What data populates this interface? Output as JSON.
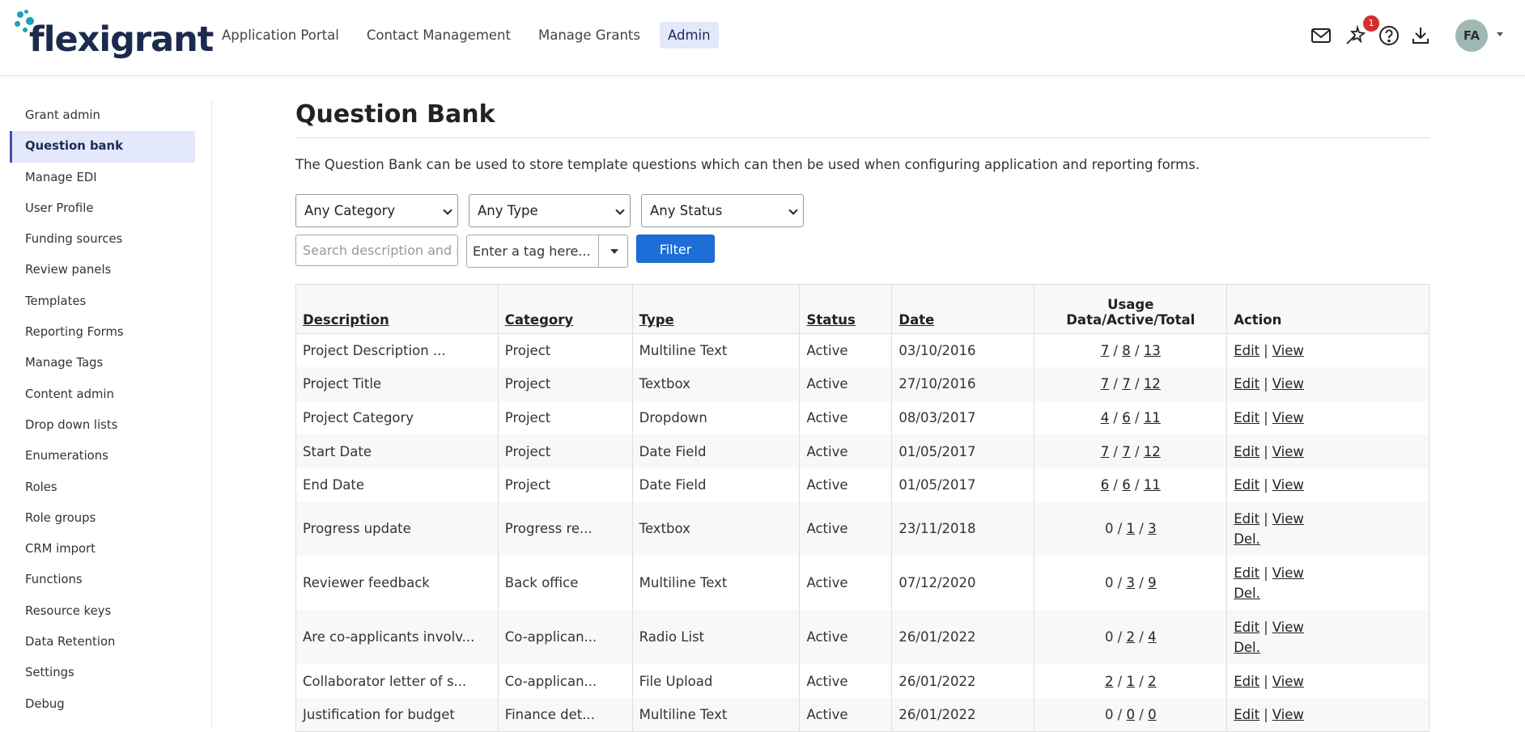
{
  "brand": {
    "name": "flexigrant",
    "accent": "#1aa3b8",
    "navy": "#1b2a4d"
  },
  "nav": {
    "items": [
      {
        "label": "Application Portal",
        "active": false
      },
      {
        "label": "Contact Management",
        "active": false
      },
      {
        "label": "Manage Grants",
        "active": false
      },
      {
        "label": "Admin",
        "active": true
      }
    ]
  },
  "header": {
    "icons": [
      "mail-icon",
      "wand-icon",
      "help-icon",
      "download-icon"
    ],
    "notification_count": "1",
    "avatar_initials": "FA"
  },
  "sidebar": {
    "items": [
      {
        "label": "Grant admin"
      },
      {
        "label": "Question bank",
        "active": true
      },
      {
        "label": "Manage EDI"
      },
      {
        "label": "User Profile"
      },
      {
        "label": "Funding sources"
      },
      {
        "label": "Review panels"
      },
      {
        "label": "Templates"
      },
      {
        "label": "Reporting Forms"
      },
      {
        "label": "Manage Tags"
      },
      {
        "label": "Content admin"
      },
      {
        "label": "Drop down lists"
      },
      {
        "label": "Enumerations"
      },
      {
        "label": "Roles"
      },
      {
        "label": "Role groups"
      },
      {
        "label": "CRM import"
      },
      {
        "label": "Functions"
      },
      {
        "label": "Resource keys"
      },
      {
        "label": "Data Retention"
      },
      {
        "label": "Settings"
      },
      {
        "label": "Debug"
      }
    ]
  },
  "page": {
    "title": "Question Bank",
    "intro": "The Question Bank can be used to store template questions which can then be used when configuring application and reporting forms."
  },
  "filters": {
    "category": "Any Category",
    "type": "Any Type",
    "status": "Any Status",
    "search_placeholder": "Search description and n",
    "tag_placeholder": "Enter a tag here...",
    "filter_label": "Filter"
  },
  "table": {
    "headers": {
      "description": "Description",
      "category": "Category",
      "type": "Type",
      "status": "Status",
      "date": "Date",
      "usage_line1": "Usage",
      "usage_line2": "Data/Active/Total",
      "action": "Action"
    },
    "action_labels": {
      "edit": "Edit",
      "sep": "|",
      "view": "View",
      "del": "Del."
    },
    "rows": [
      {
        "description": "Project Description ...",
        "category": "Project",
        "type": "Multiline Text",
        "status": "Active",
        "date": "03/10/2016",
        "data": "7",
        "active": "8",
        "total": "13",
        "data_link": true,
        "del": false
      },
      {
        "description": "Project Title",
        "category": "Project",
        "type": "Textbox",
        "status": "Active",
        "date": "27/10/2016",
        "data": "7",
        "active": "7",
        "total": "12",
        "data_link": true,
        "del": false
      },
      {
        "description": "Project Category",
        "category": "Project",
        "type": "Dropdown",
        "status": "Active",
        "date": "08/03/2017",
        "data": "4",
        "active": "6",
        "total": "11",
        "data_link": true,
        "del": false
      },
      {
        "description": "Start Date",
        "category": "Project",
        "type": "Date Field",
        "status": "Active",
        "date": "01/05/2017",
        "data": "7",
        "active": "7",
        "total": "12",
        "data_link": true,
        "del": false
      },
      {
        "description": "End Date",
        "category": "Project",
        "type": "Date Field",
        "status": "Active",
        "date": "01/05/2017",
        "data": "6",
        "active": "6",
        "total": "11",
        "data_link": true,
        "del": false
      },
      {
        "description": "Progress update",
        "category": "Progress re...",
        "type": "Textbox",
        "status": "Active",
        "date": "23/11/2018",
        "data": "0",
        "active": "1",
        "total": "3",
        "data_link": false,
        "del": true
      },
      {
        "description": "Reviewer feedback",
        "category": "Back office",
        "type": "Multiline Text",
        "status": "Active",
        "date": "07/12/2020",
        "data": "0",
        "active": "3",
        "total": "9",
        "data_link": false,
        "del": true
      },
      {
        "description": "Are co-applicants involv...",
        "category": "Co-applican...",
        "type": "Radio List",
        "status": "Active",
        "date": "26/01/2022",
        "data": "0",
        "active": "2",
        "total": "4",
        "data_link": false,
        "del": true
      },
      {
        "description": "Collaborator letter of s...",
        "category": "Co-applican...",
        "type": "File Upload",
        "status": "Active",
        "date": "26/01/2022",
        "data": "2",
        "active": "1",
        "total": "2",
        "data_link": true,
        "del": false
      },
      {
        "description": "Justification for budget",
        "category": "Finance det...",
        "type": "Multiline Text",
        "status": "Active",
        "date": "26/01/2022",
        "data": "0",
        "active": "0",
        "total": "0",
        "data_link": false,
        "del": false
      }
    ]
  }
}
